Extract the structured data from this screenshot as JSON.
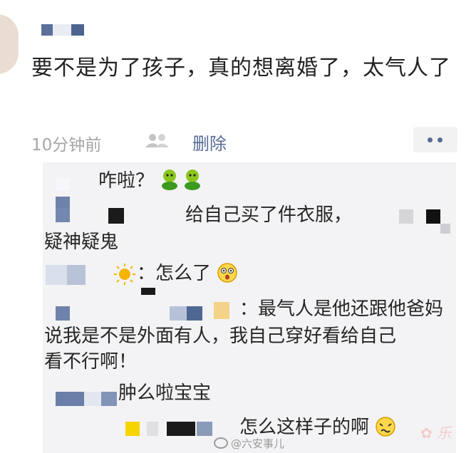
{
  "post": {
    "text": "要不是为了孩子，真的想离婚了，太气人了",
    "time": "10分钟前",
    "delete_label": "删除"
  },
  "comments": [
    {
      "text": "咋啦？",
      "emoji": "green-face-icon x2"
    },
    {
      "text": "给自己买了件衣服，"
    },
    {
      "text": "疑神疑鬼"
    },
    {
      "text": "：怎么了"
    },
    {
      "text": "：最气人是他还跟他爸妈"
    },
    {
      "text": "说我是不是外面有人，我自己穿好看给自己"
    },
    {
      "text": "看不行啊！"
    },
    {
      "text": "肿么啦宝宝"
    },
    {
      "text": "怎么这样子的啊"
    }
  ],
  "watermark": "@六安事儿",
  "colors": {
    "link": "#576b95",
    "time": "#a6a6a6",
    "comment_bg": "#f3f3f5"
  }
}
